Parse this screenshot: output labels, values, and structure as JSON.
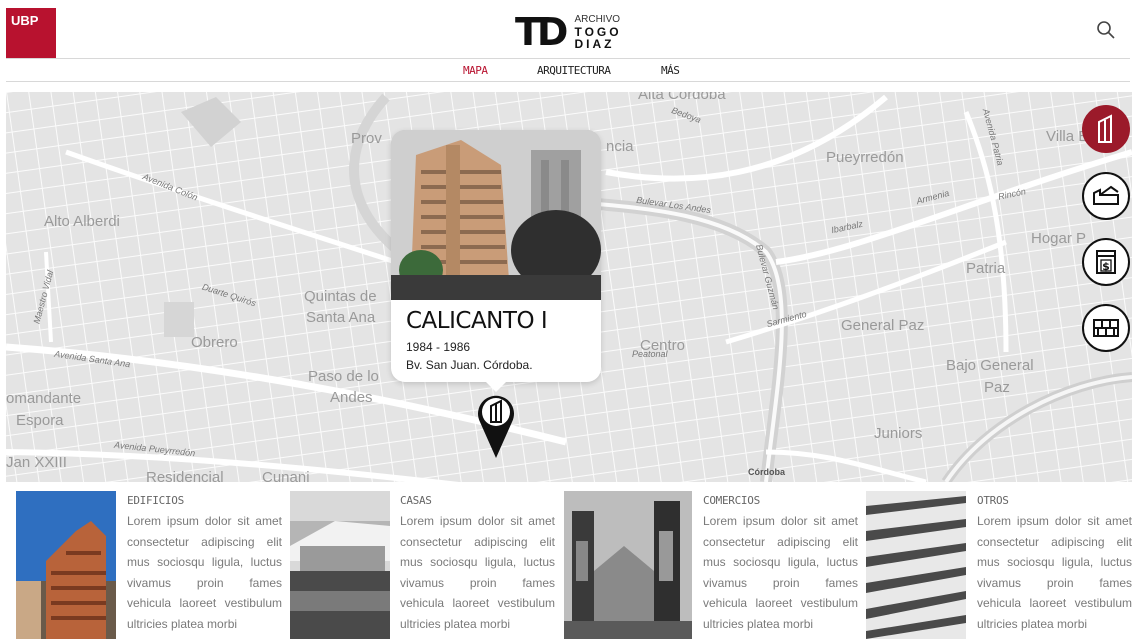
{
  "header": {
    "brand_badge": "UBP",
    "logo_mark": "TD",
    "logo_line1": "ARCHIVO",
    "logo_line2": "TOGO",
    "logo_line3": "DIAZ"
  },
  "nav": {
    "items": [
      {
        "label": "MAPA",
        "active": true
      },
      {
        "label": "ARQUITECTURA",
        "active": false
      },
      {
        "label": "MÁS",
        "active": false
      }
    ]
  },
  "map": {
    "labels": [
      "Alta Córdoba",
      "Bedoya",
      "Villa Ba",
      "Pueyrredón",
      "Avenida Patria",
      "Avenida Colón",
      "Alto Alberdi",
      "Bulevar Los Andes",
      "Armenia",
      "Rincón",
      "Ibarbalz",
      "Hogar P",
      "Patria",
      "Duarte Quirós",
      "Quintas de",
      "Santa Ana",
      "Obrero",
      "Sarmiento",
      "General Paz",
      "Avenida Santa Ana",
      "Centro",
      "Peatonal",
      "Paso de lo",
      "Andes",
      "Bajo General",
      "Paz",
      "omandante",
      "Espora",
      "Juniors",
      "Jan XXIII",
      "Avenida Pueyrredón",
      "Residencial",
      "Cunani",
      "Córdoba",
      "Prov",
      "ncia",
      "Maestro Vidal",
      "Bulevar Guzmán"
    ],
    "popup": {
      "title": "CALICANTO I",
      "years": "1984 - 1986",
      "address": "Bv. San Juan. Córdoba."
    },
    "category_buttons": [
      {
        "name": "edificios",
        "icon": "building-icon",
        "active": true
      },
      {
        "name": "casas",
        "icon": "house-icon",
        "active": false
      },
      {
        "name": "comercios",
        "icon": "shop-icon",
        "active": false
      },
      {
        "name": "otros",
        "icon": "brick-wall-icon",
        "active": false
      }
    ]
  },
  "cards": [
    {
      "title": "EDIFICIOS",
      "text": "Lorem ipsum dolor sit amet consectetur adipiscing elit mus sociosqu ligula, luctus vivamus proin fames vehicula laoreet vestibulum ultricies platea morbi"
    },
    {
      "title": "CASAS",
      "text": "Lorem ipsum dolor sit amet consectetur adipiscing elit mus sociosqu ligula, luctus vivamus proin fames vehicula laoreet vestibulum ultricies platea morbi"
    },
    {
      "title": "COMERCIOS",
      "text": "Lorem ipsum dolor sit amet consectetur adipiscing elit mus sociosqu ligula, luctus vivamus proin fames vehicula laoreet vestibulum ultricies platea morbi"
    },
    {
      "title": "OTROS",
      "text": "Lorem ipsum dolor sit amet consectetur adipiscing elit mus sociosqu ligula, luctus vivamus proin fames vehicula laoreet vestibulum ultricies platea morbi"
    }
  ],
  "colors": {
    "accent": "#b8122f",
    "active_button": "#9b1a2a",
    "map_bg": "#e7e7e7"
  }
}
